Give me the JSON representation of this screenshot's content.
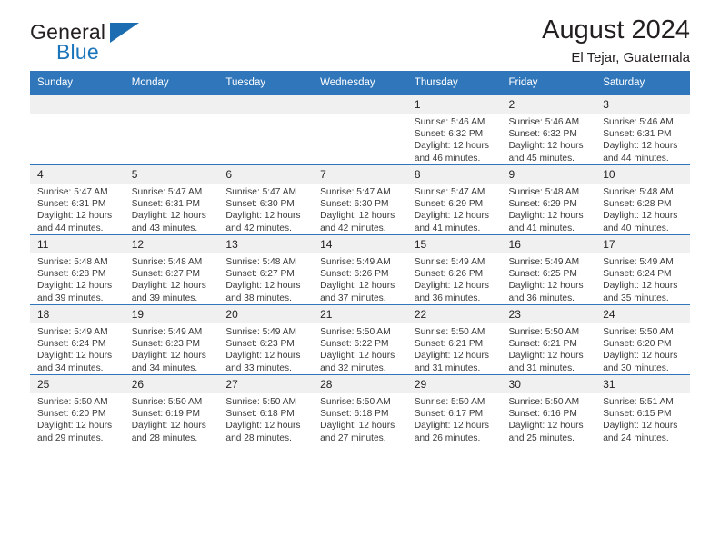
{
  "brand": {
    "name_top": "General",
    "name_bottom": "Blue",
    "accent_color": "#1b75bb"
  },
  "header": {
    "title": "August 2024",
    "subtitle": "El Tejar, Guatemala"
  },
  "calendar": {
    "header_bg": "#2f76ba",
    "daynum_bg": "#f0f0f0",
    "weekday_headers": [
      "Sunday",
      "Monday",
      "Tuesday",
      "Wednesday",
      "Thursday",
      "Friday",
      "Saturday"
    ],
    "weeks": [
      [
        {
          "day": "",
          "empty": true
        },
        {
          "day": "",
          "empty": true
        },
        {
          "day": "",
          "empty": true
        },
        {
          "day": "",
          "empty": true
        },
        {
          "day": "1",
          "sunrise": "Sunrise: 5:46 AM",
          "sunset": "Sunset: 6:32 PM",
          "daylight": "Daylight: 12 hours and 46 minutes."
        },
        {
          "day": "2",
          "sunrise": "Sunrise: 5:46 AM",
          "sunset": "Sunset: 6:32 PM",
          "daylight": "Daylight: 12 hours and 45 minutes."
        },
        {
          "day": "3",
          "sunrise": "Sunrise: 5:46 AM",
          "sunset": "Sunset: 6:31 PM",
          "daylight": "Daylight: 12 hours and 44 minutes."
        }
      ],
      [
        {
          "day": "4",
          "sunrise": "Sunrise: 5:47 AM",
          "sunset": "Sunset: 6:31 PM",
          "daylight": "Daylight: 12 hours and 44 minutes."
        },
        {
          "day": "5",
          "sunrise": "Sunrise: 5:47 AM",
          "sunset": "Sunset: 6:31 PM",
          "daylight": "Daylight: 12 hours and 43 minutes."
        },
        {
          "day": "6",
          "sunrise": "Sunrise: 5:47 AM",
          "sunset": "Sunset: 6:30 PM",
          "daylight": "Daylight: 12 hours and 42 minutes."
        },
        {
          "day": "7",
          "sunrise": "Sunrise: 5:47 AM",
          "sunset": "Sunset: 6:30 PM",
          "daylight": "Daylight: 12 hours and 42 minutes."
        },
        {
          "day": "8",
          "sunrise": "Sunrise: 5:47 AM",
          "sunset": "Sunset: 6:29 PM",
          "daylight": "Daylight: 12 hours and 41 minutes."
        },
        {
          "day": "9",
          "sunrise": "Sunrise: 5:48 AM",
          "sunset": "Sunset: 6:29 PM",
          "daylight": "Daylight: 12 hours and 41 minutes."
        },
        {
          "day": "10",
          "sunrise": "Sunrise: 5:48 AM",
          "sunset": "Sunset: 6:28 PM",
          "daylight": "Daylight: 12 hours and 40 minutes."
        }
      ],
      [
        {
          "day": "11",
          "sunrise": "Sunrise: 5:48 AM",
          "sunset": "Sunset: 6:28 PM",
          "daylight": "Daylight: 12 hours and 39 minutes."
        },
        {
          "day": "12",
          "sunrise": "Sunrise: 5:48 AM",
          "sunset": "Sunset: 6:27 PM",
          "daylight": "Daylight: 12 hours and 39 minutes."
        },
        {
          "day": "13",
          "sunrise": "Sunrise: 5:48 AM",
          "sunset": "Sunset: 6:27 PM",
          "daylight": "Daylight: 12 hours and 38 minutes."
        },
        {
          "day": "14",
          "sunrise": "Sunrise: 5:49 AM",
          "sunset": "Sunset: 6:26 PM",
          "daylight": "Daylight: 12 hours and 37 minutes."
        },
        {
          "day": "15",
          "sunrise": "Sunrise: 5:49 AM",
          "sunset": "Sunset: 6:26 PM",
          "daylight": "Daylight: 12 hours and 36 minutes."
        },
        {
          "day": "16",
          "sunrise": "Sunrise: 5:49 AM",
          "sunset": "Sunset: 6:25 PM",
          "daylight": "Daylight: 12 hours and 36 minutes."
        },
        {
          "day": "17",
          "sunrise": "Sunrise: 5:49 AM",
          "sunset": "Sunset: 6:24 PM",
          "daylight": "Daylight: 12 hours and 35 minutes."
        }
      ],
      [
        {
          "day": "18",
          "sunrise": "Sunrise: 5:49 AM",
          "sunset": "Sunset: 6:24 PM",
          "daylight": "Daylight: 12 hours and 34 minutes."
        },
        {
          "day": "19",
          "sunrise": "Sunrise: 5:49 AM",
          "sunset": "Sunset: 6:23 PM",
          "daylight": "Daylight: 12 hours and 34 minutes."
        },
        {
          "day": "20",
          "sunrise": "Sunrise: 5:49 AM",
          "sunset": "Sunset: 6:23 PM",
          "daylight": "Daylight: 12 hours and 33 minutes."
        },
        {
          "day": "21",
          "sunrise": "Sunrise: 5:50 AM",
          "sunset": "Sunset: 6:22 PM",
          "daylight": "Daylight: 12 hours and 32 minutes."
        },
        {
          "day": "22",
          "sunrise": "Sunrise: 5:50 AM",
          "sunset": "Sunset: 6:21 PM",
          "daylight": "Daylight: 12 hours and 31 minutes."
        },
        {
          "day": "23",
          "sunrise": "Sunrise: 5:50 AM",
          "sunset": "Sunset: 6:21 PM",
          "daylight": "Daylight: 12 hours and 31 minutes."
        },
        {
          "day": "24",
          "sunrise": "Sunrise: 5:50 AM",
          "sunset": "Sunset: 6:20 PM",
          "daylight": "Daylight: 12 hours and 30 minutes."
        }
      ],
      [
        {
          "day": "25",
          "sunrise": "Sunrise: 5:50 AM",
          "sunset": "Sunset: 6:20 PM",
          "daylight": "Daylight: 12 hours and 29 minutes."
        },
        {
          "day": "26",
          "sunrise": "Sunrise: 5:50 AM",
          "sunset": "Sunset: 6:19 PM",
          "daylight": "Daylight: 12 hours and 28 minutes."
        },
        {
          "day": "27",
          "sunrise": "Sunrise: 5:50 AM",
          "sunset": "Sunset: 6:18 PM",
          "daylight": "Daylight: 12 hours and 28 minutes."
        },
        {
          "day": "28",
          "sunrise": "Sunrise: 5:50 AM",
          "sunset": "Sunset: 6:18 PM",
          "daylight": "Daylight: 12 hours and 27 minutes."
        },
        {
          "day": "29",
          "sunrise": "Sunrise: 5:50 AM",
          "sunset": "Sunset: 6:17 PM",
          "daylight": "Daylight: 12 hours and 26 minutes."
        },
        {
          "day": "30",
          "sunrise": "Sunrise: 5:50 AM",
          "sunset": "Sunset: 6:16 PM",
          "daylight": "Daylight: 12 hours and 25 minutes."
        },
        {
          "day": "31",
          "sunrise": "Sunrise: 5:51 AM",
          "sunset": "Sunset: 6:15 PM",
          "daylight": "Daylight: 12 hours and 24 minutes."
        }
      ]
    ]
  }
}
